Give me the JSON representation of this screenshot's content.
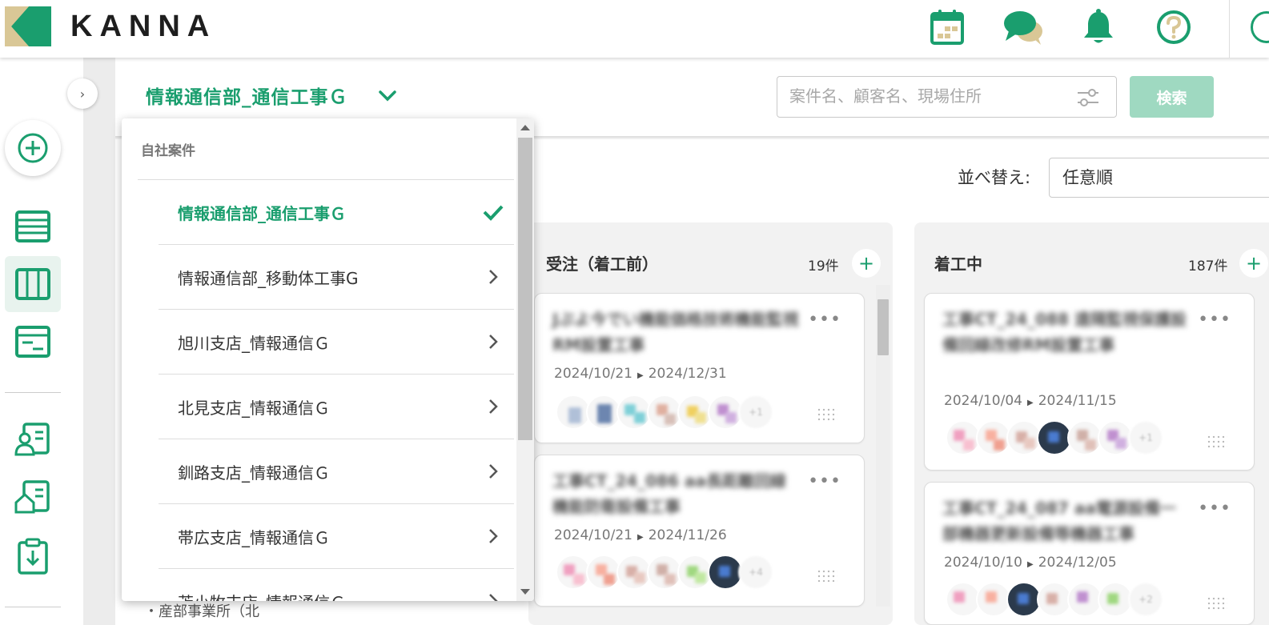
{
  "app": {
    "logo_text": "KANNA"
  },
  "brand_colors": {
    "accent": "#1a9e6e",
    "search_button": "#9fd9c1",
    "logo_tan": "#d9c796"
  },
  "header_icons": [
    "calendar-icon",
    "chat-icon",
    "bell-icon",
    "help-icon"
  ],
  "sidebar": {
    "toggle_icon": "chevron-right-icon",
    "add_icon": "plus-circle-icon",
    "items": [
      {
        "name": "list-view",
        "icon": "list-icon",
        "active": false
      },
      {
        "name": "board-view",
        "icon": "board-columns-icon",
        "active": true
      },
      {
        "name": "gantt-view",
        "icon": "schedule-card-icon",
        "active": false
      },
      {
        "name": "customer",
        "icon": "customer-card-icon",
        "active": false
      },
      {
        "name": "property",
        "icon": "property-card-icon",
        "active": false
      },
      {
        "name": "report-download",
        "icon": "clipboard-download-icon",
        "active": false
      }
    ]
  },
  "main": {
    "department_selector": "情報通信部_通信工事Ｇ",
    "search": {
      "placeholder": "案件名、顧客名、現場住所",
      "button_label": "検索"
    },
    "sort": {
      "label": "並べ替え:",
      "selected": "任意順"
    }
  },
  "dropdown": {
    "section_label": "自社案件",
    "items": [
      {
        "label": "情報通信部_通信工事Ｇ",
        "selected": true
      },
      {
        "label": "情報通信部_移動体工事G",
        "selected": false
      },
      {
        "label": "旭川支店_情報通信Ｇ",
        "selected": false
      },
      {
        "label": "北見支店_情報通信Ｇ",
        "selected": false
      },
      {
        "label": "釧路支店_情報通信Ｇ",
        "selected": false
      },
      {
        "label": "帯広支店_情報通信Ｇ",
        "selected": false
      },
      {
        "label": "苫小牧支店_情報通信Ｇ",
        "selected": false
      }
    ],
    "partial_text_below": "・産部事業所（北"
  },
  "columns": [
    {
      "title": "受注（着工前）",
      "count": "19件",
      "cards": [
        {
          "title": "Jぶよ今でい機能価格技術機能監視RM設置工事",
          "start": "2024/10/21",
          "end": "2024/12/31"
        },
        {
          "title": "工事CT_24_086 aa長距離回線機能防衛設備工事",
          "start": "2024/10/21",
          "end": "2024/11/26"
        }
      ]
    },
    {
      "title": "着工中",
      "count": "187件",
      "cards": [
        {
          "title": "工事CT_24_088 遠隔監視保護設備回線改修RM設置工事",
          "start": "2024/10/04",
          "end": "2024/11/15"
        },
        {
          "title": "工事CT_24_087 aa電源設備一部機器更新設備等機器工事",
          "start": "2024/10/10",
          "end": "2024/12/05"
        }
      ]
    }
  ]
}
